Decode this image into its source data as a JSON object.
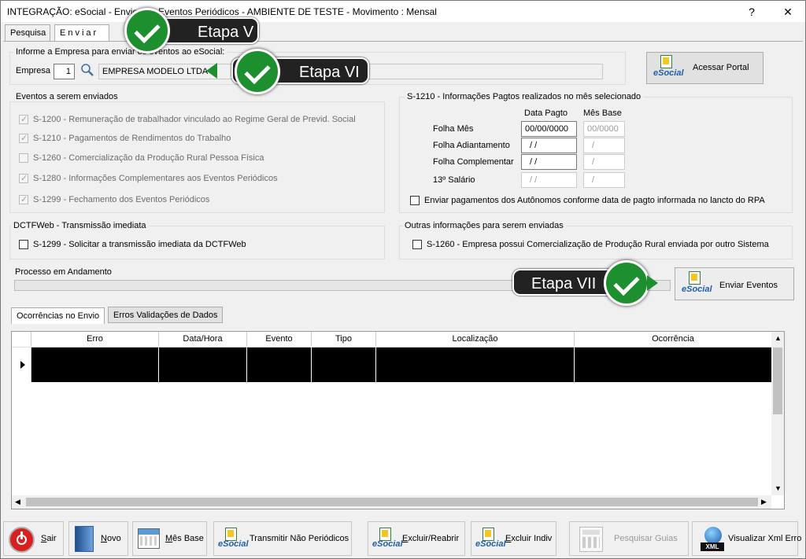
{
  "window": {
    "title": "INTEGRAÇÃO: eSocial - Envio dos Eventos Periódicos - AMBIENTE DE TESTE - Movimento : Mensal",
    "help_label": "?",
    "close_label": "✕"
  },
  "tabs": [
    {
      "label": "Pesquisa"
    },
    {
      "label": "Enviar"
    }
  ],
  "empresa": {
    "group_label": "Informe a Empresa para enviar os eventos ao eSocial:",
    "label": "Empresa",
    "code": "1",
    "name": "EMPRESA MODELO LTDA"
  },
  "portal": {
    "logo_text": "eSocial",
    "label": "Acessar Portal"
  },
  "eventos": {
    "group_label": "Eventos a serem enviados",
    "items": [
      {
        "label": "S-1200 - Remuneração de trabalhador vinculado ao Regime Geral de Previd. Social",
        "checked": true
      },
      {
        "label": "S-1210 - Pagamentos de Rendimentos do Trabalho",
        "checked": true
      },
      {
        "label": "S-1260 - Comercialização da Produção Rural Pessoa Física",
        "checked": false
      },
      {
        "label": "S-1280 - Informações Complementares aos Eventos Periódicos",
        "checked": true
      },
      {
        "label": "S-1299 - Fechamento dos Eventos Periódicos",
        "checked": true
      }
    ]
  },
  "s1210": {
    "group_label": "S-1210 - Informações Pagtos realizados no mês selecionado",
    "col_data": "Data Pagto",
    "col_mes": "Mês Base",
    "rows": [
      {
        "label": "Folha Mês",
        "data": "00/00/0000",
        "mes": "00/0000"
      },
      {
        "label": "Folha Adiantamento",
        "data": "/ /",
        "mes": "/"
      },
      {
        "label": "Folha Complementar",
        "data": "/ /",
        "mes": "/"
      },
      {
        "label": "13º Salário",
        "data": "/ /",
        "mes": "/"
      }
    ],
    "autonomos_label": "Enviar pagamentos dos Autônomos conforme data de pagto informada no lancto do RPA"
  },
  "dctf": {
    "group_label": "DCTFWeb - Transmissão imediata",
    "item": "S-1299 - Solicitar a transmissão imediata da DCTFWeb"
  },
  "outras": {
    "group_label": "Outras informações para serem enviadas",
    "item": "S-1260 - Empresa possui Comercialização de Produção Rural enviada por outro Sistema"
  },
  "processo": {
    "label": "Processo em Andamento",
    "progress": 0
  },
  "enviar": {
    "logo_text": "eSocial",
    "label": "Enviar Eventos"
  },
  "callouts": {
    "v": "Etapa V",
    "vi": "Etapa VI",
    "vii": "Etapa VII"
  },
  "subtabs": [
    {
      "label": "Ocorrências no Envio"
    },
    {
      "label": "Erros Validações de Dados"
    }
  ],
  "grid": {
    "columns": [
      "Erro",
      "Data/Hora",
      "Evento",
      "Tipo",
      "Localização",
      "Ocorrência"
    ]
  },
  "toolbar": {
    "sair": {
      "first": "S",
      "rest": "air"
    },
    "novo": {
      "first": "N",
      "rest": "ovo"
    },
    "mesbase": {
      "first": "M",
      "rest": "ês Base"
    },
    "transmitir": {
      "logo": "eSocial",
      "label": "Transmitir Não Periódicos"
    },
    "excluir_reabrir": {
      "logo": "eSocial",
      "first": "E",
      "rest": "xcluir/Reabrir"
    },
    "excluir_indiv": {
      "logo": "eSocial",
      "first": "E",
      "rest": "xcluir Indiv"
    },
    "guias": {
      "label": "Pesquisar Guias"
    },
    "xml": {
      "icon_text": "XML",
      "label": "Visualizar Xml Erro"
    }
  },
  "colors": {
    "accent": "#1e8f2f",
    "grid_row": "#000000",
    "callout": "#222222"
  }
}
